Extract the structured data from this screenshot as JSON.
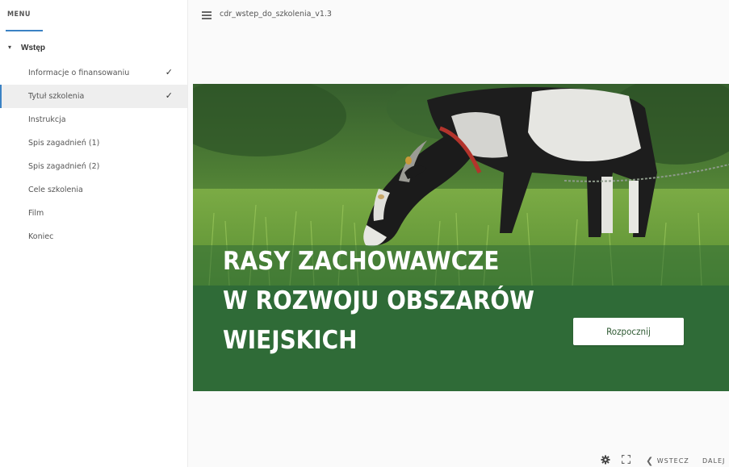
{
  "sidebar": {
    "menu_title": "MENU",
    "section_label": "Wstęp",
    "items": [
      {
        "label": "Informacje o finansowaniu",
        "done": true
      },
      {
        "label": "Tytuł szkolenia",
        "done": true
      },
      {
        "label": "Instrukcja",
        "done": false
      },
      {
        "label": "Spis zagadnień (1)",
        "done": false
      },
      {
        "label": "Spis zagadnień (2)",
        "done": false
      },
      {
        "label": "Cele szkolenia",
        "done": false
      },
      {
        "label": "Film",
        "done": false
      },
      {
        "label": "Koniec",
        "done": false
      }
    ],
    "check_glyph": "✓",
    "active_index": 1
  },
  "topbar": {
    "course_title": "cdr_wstep_do_szkolenia_v1.3"
  },
  "slide": {
    "headline_line1": "RASY ZACHOWAWCZE",
    "headline_line2": "W ROZWOJU OBSZARÓW",
    "headline_line3": "WIEJSKICH",
    "start_button": "Rozpocznij",
    "banner_color": "#2f6b37"
  },
  "controls": {
    "settings_icon": "gear-icon",
    "fullscreen_icon": "fullscreen-icon",
    "prev_label": "WSTECZ",
    "next_label": "DALEJ"
  },
  "colors": {
    "accent": "#3b82c4",
    "banner": "#2f6b37"
  }
}
